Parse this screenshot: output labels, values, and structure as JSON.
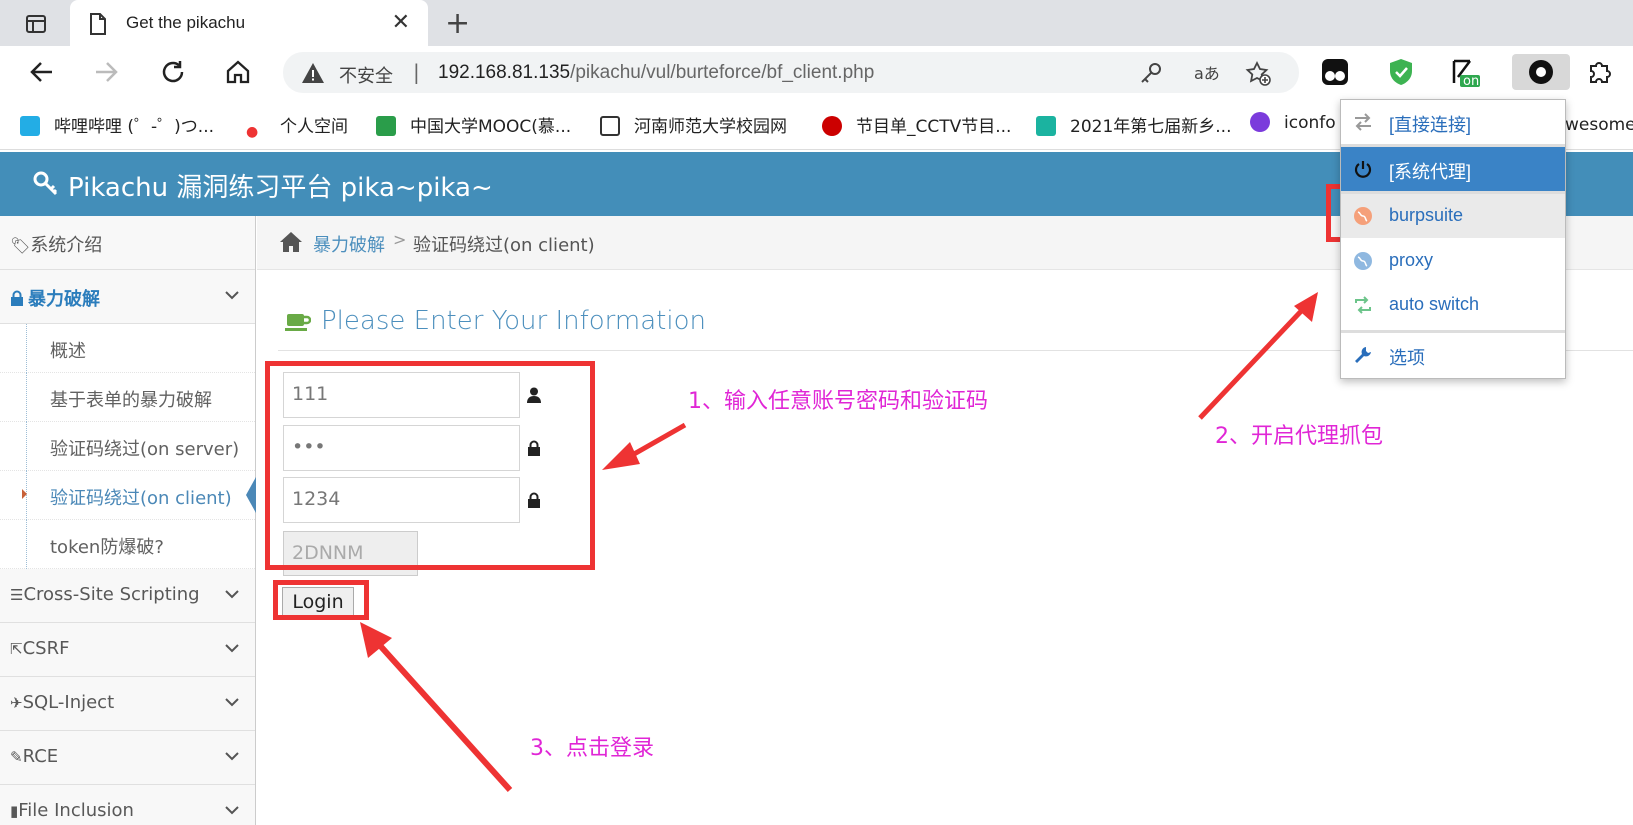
{
  "browser": {
    "tab_title": "Get the pikachu",
    "tab_close": "✕",
    "new_tab": "+",
    "address": {
      "security_label": "不安全",
      "separator": "|",
      "url_host": "192.168.81.135",
      "url_path": "/pikachu/vul/burteforce/bf_client.php"
    },
    "extension_badge": "on"
  },
  "bookmarks": [
    {
      "label": "哔哩哔哩 (゜-゜)つ...",
      "color": "#23ade5"
    },
    {
      "label": "个人空间",
      "color": "#e33"
    },
    {
      "label": "中国大学MOOC(慕...",
      "color": "#2a9d4a"
    },
    {
      "label": "河南师范大学校园网",
      "color": "#ffffff"
    },
    {
      "label": "节目单_CCTV节目...",
      "color": "#c00"
    },
    {
      "label": "2021年第七届新乡...",
      "color": "#1bb3a0"
    },
    {
      "label": "iconfo",
      "color": "#7b3bdc"
    }
  ],
  "bookmark_overflow": "wesome",
  "proxy_menu": {
    "items": [
      {
        "label": "[直接连接]",
        "icon": "swap-arrows-icon"
      },
      {
        "label": "[系统代理]",
        "icon": "power-icon"
      },
      {
        "label": "burpsuite",
        "icon": "globe-icon-orange"
      },
      {
        "label": "proxy",
        "icon": "globe-icon-blue"
      },
      {
        "label": "auto switch",
        "icon": "retweet-icon"
      },
      {
        "label": "选项",
        "icon": "wrench-icon"
      }
    ]
  },
  "app": {
    "brand": "Pikachu 漏洞练习平台 pika~pika~",
    "sidebar": {
      "items": [
        {
          "label": "系统介绍",
          "icon": "tags-icon"
        },
        {
          "label": "暴力破解",
          "icon": "lock-icon",
          "active": true
        },
        {
          "label": "Cross-Site Scripting",
          "icon": "indent-icon"
        },
        {
          "label": "CSRF",
          "icon": "share-icon"
        },
        {
          "label": "SQL-Inject",
          "icon": "plane-icon"
        },
        {
          "label": "RCE",
          "icon": "pencil-icon"
        },
        {
          "label": "File Inclusion",
          "icon": "file-icon"
        }
      ],
      "subitems": [
        {
          "label": "概述"
        },
        {
          "label": "基于表单的暴力破解"
        },
        {
          "label": "验证码绕过(on server)"
        },
        {
          "label": "验证码绕过(on client)",
          "current": true
        },
        {
          "label": "token防爆破?"
        }
      ]
    },
    "breadcrumb": {
      "parent": "暴力破解",
      "separator": ">",
      "current": "验证码绕过(on client)"
    },
    "form": {
      "title": "Please Enter Your Information",
      "username_value": "111",
      "password_value": "•••",
      "captcha_value": "1234",
      "captcha_image_text": "2DNNM",
      "login_label": "Login"
    }
  },
  "annotations": {
    "step1": "1、输入任意账号密码和验证码",
    "step2": "2、开启代理抓包",
    "step3": "3、点击登录"
  }
}
